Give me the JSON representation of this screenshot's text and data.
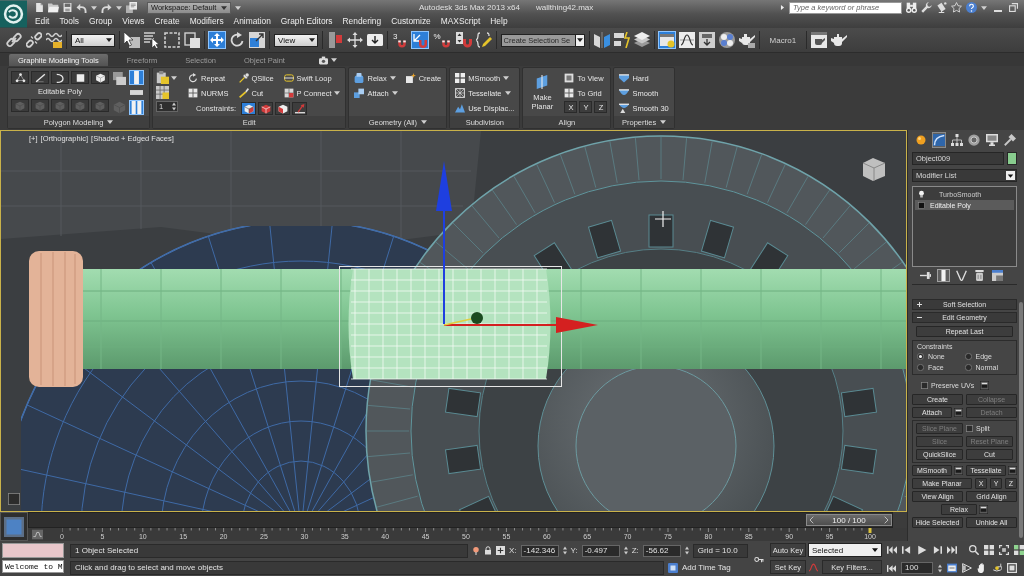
{
  "title_bar": {
    "workspace": "Workspace: Default",
    "app_title": "Autodesk 3ds Max 2013 x64",
    "file_name": "wallthing42.max",
    "search": {
      "placeholder": "Type a keyword or phrase"
    }
  },
  "menu": [
    "Edit",
    "Tools",
    "Group",
    "Views",
    "Create",
    "Modifiers",
    "Animation",
    "Graph Editors",
    "Rendering",
    "Customize",
    "MAXScript",
    "Help"
  ],
  "main_toolbar": [
    {
      "kind": "icon",
      "on": false
    },
    {
      "kind": "icon",
      "on": false
    },
    {
      "kind": "icon",
      "on": false
    },
    {
      "kind": "dropdown",
      "value": "All"
    },
    {
      "kind": "icon",
      "on": false
    },
    {
      "kind": "icon",
      "on": false
    },
    {
      "kind": "icon",
      "on": false
    },
    {
      "kind": "icon",
      "on": false
    },
    {
      "kind": "icon",
      "on": true
    },
    {
      "kind": "icon",
      "on": false
    },
    {
      "kind": "icon",
      "on": false
    },
    {
      "kind": "dropdown",
      "value": "View"
    },
    {
      "kind": "icon",
      "on": false
    },
    {
      "kind": "icon",
      "on": false
    },
    {
      "kind": "icon",
      "on": false
    },
    {
      "kind": "snap",
      "text": "3",
      "on": false
    },
    {
      "kind": "icon",
      "on": true
    },
    {
      "kind": "snap",
      "text": "%",
      "on": false
    },
    {
      "kind": "icon",
      "on": false
    },
    {
      "kind": "icon",
      "on": false
    },
    {
      "kind": "combo",
      "placeholder": "Create Selection Se"
    },
    {
      "kind": "icon",
      "on": false
    },
    {
      "kind": "icon",
      "on": false
    },
    {
      "kind": "icon",
      "on": false
    },
    {
      "kind": "icon",
      "on": true
    },
    {
      "kind": "icon",
      "on": false
    },
    {
      "kind": "icon",
      "on": false
    },
    {
      "kind": "icon",
      "on": false
    },
    {
      "kind": "icon",
      "on": false
    },
    {
      "kind": "label",
      "text": "Macro1"
    },
    {
      "kind": "icon",
      "on": false
    },
    {
      "kind": "icon",
      "on": false
    }
  ],
  "ribbon": {
    "tabs": [
      {
        "label": "Graphite Modeling Tools",
        "selected": true
      },
      {
        "label": "Freeform",
        "selected": false
      },
      {
        "label": "Selection",
        "selected": false
      },
      {
        "label": "Object Paint",
        "selected": false
      }
    ],
    "panels": [
      {
        "kind": "polygon_modeling",
        "title": "Polygon Modeling",
        "title_menu": true,
        "mode": "Editable Poly",
        "levels": [
          {
            "selected": false
          },
          {
            "selected": false
          },
          {
            "selected": false
          },
          {
            "selected": false
          },
          {
            "selected": false
          }
        ],
        "level_tools": [
          {
            "disabled": true
          },
          {
            "disabled": true
          },
          {
            "disabled": true
          },
          {
            "disabled": true
          },
          {
            "disabled": true
          }
        ],
        "side_tools": [
          {
            "on": false,
            "disabled": false
          },
          {
            "on": true,
            "disabled": false
          },
          {
            "on": false,
            "disabled": false
          },
          {
            "on": true,
            "disabled": false
          },
          {
            "on": false,
            "disabled": true
          }
        ]
      },
      {
        "kind": "edit",
        "title": "Edit",
        "spinner": "1",
        "rows": [
          [
            {
              "label": "Repeat"
            },
            {
              "label": "QSlice"
            },
            {
              "label": "Swift Loop"
            }
          ],
          [
            {
              "label": "NURMS"
            },
            {
              "label": "Cut"
            },
            {
              "label": "P Connect",
              "menu": true
            }
          ]
        ],
        "constraints": {
          "label": "Constraints:",
          "options": [
            {
              "selected": true
            },
            {
              "selected": false
            },
            {
              "selected": false
            },
            {
              "selected": false
            }
          ]
        }
      },
      {
        "kind": "geometry",
        "title": "Geometry (All)",
        "title_menu": true,
        "rows": [
          [
            {
              "label": "Relax",
              "menu": true
            },
            {
              "label": "Create"
            }
          ],
          [
            {
              "label": "Attach",
              "menu": true
            }
          ]
        ]
      },
      {
        "kind": "subdivision",
        "title": "Subdivision",
        "rows": [
          [
            {
              "label": "MSmooth",
              "menu": true
            }
          ],
          [
            {
              "label": "Tessellate",
              "menu": true
            }
          ],
          [
            {
              "label": "Use Displac..."
            }
          ]
        ]
      },
      {
        "kind": "align",
        "title": "Align",
        "big": "Make Planar",
        "rows": [
          [
            {
              "label": "To View"
            }
          ],
          [
            {
              "label": "To Grid"
            }
          ]
        ],
        "axes": [
          "X",
          "Y",
          "Z"
        ]
      },
      {
        "kind": "properties",
        "title": "Properties",
        "title_menu": true,
        "rows": [
          [
            {
              "label": "Hard"
            }
          ],
          [
            {
              "label": "Smooth"
            }
          ],
          [
            {
              "label": "Smooth 30"
            }
          ]
        ]
      }
    ]
  },
  "viewport": {
    "labels": [
      "[+]",
      "[Orthographic]",
      "[Shaded + Edged Faces]"
    ],
    "active": true
  },
  "command_panel": {
    "tabs": [
      {
        "selected": false
      },
      {
        "selected": true
      },
      {
        "selected": false
      },
      {
        "selected": false
      },
      {
        "selected": false
      },
      {
        "selected": false
      }
    ],
    "object_name": "Object009",
    "modifier_list": "Modifier List",
    "stack": [
      {
        "label": "TurboSmooth",
        "selected": false,
        "kind": "modifier"
      },
      {
        "label": "Editable Poly",
        "selected": true,
        "kind": "base_object"
      }
    ],
    "stack_tools": [
      {
        "on": false
      },
      {
        "on": true
      },
      {
        "on": false
      },
      {
        "on": false
      },
      {
        "on": false
      }
    ],
    "rollouts": [
      {
        "label": "Soft Selection",
        "expanded": false
      },
      {
        "label": "Edit Geometry",
        "expanded": true
      }
    ],
    "repeat_last": "Repeat Last",
    "constraints": {
      "title": "Constraints",
      "options": [
        {
          "label": "None",
          "selected": true
        },
        {
          "label": "Edge",
          "selected": false
        },
        {
          "label": "Face",
          "selected": false
        },
        {
          "label": "Normal",
          "selected": false
        }
      ]
    },
    "preserve_uvs": {
      "label": "Preserve UVs",
      "checked": false,
      "settings": true
    },
    "sections": [
      {
        "boxed": false,
        "rows": [
          [
            {
              "kind": "button",
              "label": "Create",
              "disabled": false
            },
            {
              "kind": "button",
              "label": "Collapse",
              "disabled": true
            }
          ],
          [
            {
              "kind": "button",
              "label": "Attach",
              "disabled": false,
              "settings": true
            },
            {
              "kind": "button",
              "label": "Detach",
              "disabled": true
            }
          ]
        ]
      },
      {
        "boxed": true,
        "rows": [
          [
            {
              "kind": "button",
              "label": "Slice Plane",
              "disabled": true
            },
            {
              "kind": "checkbox",
              "label": "Split",
              "checked": false,
              "disabled": false
            }
          ],
          [
            {
              "kind": "button",
              "label": "Slice",
              "disabled": true
            },
            {
              "kind": "button",
              "label": "Reset Plane",
              "disabled": true
            }
          ],
          [
            {
              "kind": "button",
              "label": "QuickSlice",
              "disabled": false
            },
            {
              "kind": "button",
              "label": "Cut",
              "disabled": false
            }
          ]
        ]
      },
      {
        "boxed": false,
        "rows": [
          [
            {
              "kind": "button",
              "label": "MSmooth",
              "disabled": false,
              "settings": true
            },
            {
              "kind": "button",
              "label": "Tessellate",
              "disabled": false,
              "settings": true
            }
          ],
          [
            {
              "kind": "button",
              "label": "Make Planar",
              "disabled": false
            },
            {
              "kind": "button",
              "label": "X",
              "disabled": false
            },
            {
              "kind": "button",
              "label": "Y",
              "disabled": false
            },
            {
              "kind": "button",
              "label": "Z",
              "disabled": false
            }
          ],
          [
            {
              "kind": "button",
              "label": "View Align",
              "disabled": false
            },
            {
              "kind": "button",
              "label": "Grid Align",
              "disabled": false
            }
          ],
          [
            {
              "kind": "button",
              "label": "Relax",
              "disabled": false,
              "settings": true
            }
          ],
          [
            {
              "kind": "button",
              "label": "Hide Selected",
              "disabled": false
            },
            {
              "kind": "button",
              "label": "Unhide All",
              "disabled": false
            }
          ]
        ]
      }
    ]
  },
  "timeline": {
    "slider": {
      "label": "100 / 100",
      "level": 1
    },
    "ruler": [
      "0",
      "5",
      "10",
      "15",
      "20",
      "25",
      "30",
      "35",
      "40",
      "45",
      "50",
      "55",
      "60",
      "65",
      "70",
      "75",
      "80",
      "85",
      "90",
      "95",
      "100"
    ]
  },
  "status_bar": {
    "listener": "Welcome to M",
    "selection": "1 Object Selected",
    "prompt": "Click and drag to select and move objects",
    "coords": [
      {
        "axis": "X:",
        "value": "-142.346"
      },
      {
        "axis": "Y:",
        "value": "-0.497"
      },
      {
        "axis": "Z:",
        "value": "-56.62"
      }
    ],
    "grid": "Grid = 10.0",
    "time_tag": "Add Time Tag",
    "auto_key": {
      "label": "Auto Key",
      "on": false
    },
    "key_set": "Selected",
    "set_key": "Set Key",
    "key_filters": "Key Filters...",
    "frame": "100"
  }
}
